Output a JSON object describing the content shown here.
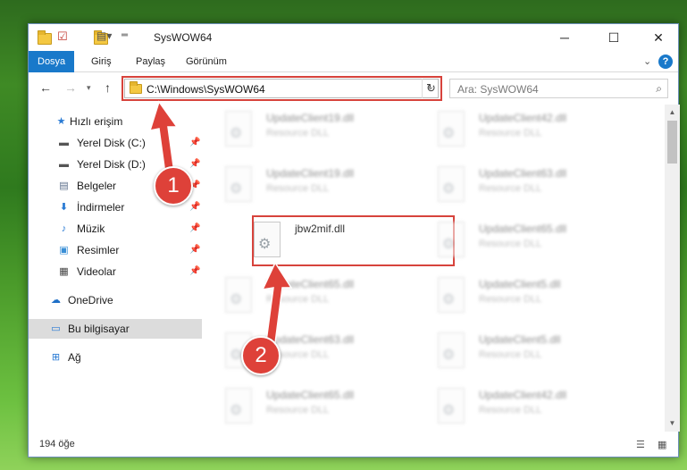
{
  "window": {
    "title": "SysWOW64"
  },
  "titlebar": {
    "minimize": "─",
    "maximize": "☐",
    "close": "✕"
  },
  "ribbon": {
    "tabs": [
      "Dosya",
      "Giriş",
      "Paylaş",
      "Görünüm"
    ],
    "active": 0
  },
  "address": {
    "path": "C:\\Windows\\SysWOW64",
    "search_placeholder": "Ara: SysWOW64"
  },
  "sidebar": {
    "items": [
      {
        "label": "Hızlı erişim",
        "icon": "star-icon"
      },
      {
        "label": "Yerel Disk (C:)",
        "icon": "drive-icon",
        "pinned": true
      },
      {
        "label": "Yerel Disk (D:)",
        "icon": "drive-icon",
        "pinned": true
      },
      {
        "label": "Belgeler",
        "icon": "documents-icon",
        "pinned": true
      },
      {
        "label": "İndirmeler",
        "icon": "download-icon",
        "pinned": true
      },
      {
        "label": "Müzik",
        "icon": "music-icon",
        "pinned": true
      },
      {
        "label": "Resimler",
        "icon": "pictures-icon",
        "pinned": true
      },
      {
        "label": "Videolar",
        "icon": "videos-icon",
        "pinned": true
      },
      {
        "label": "OneDrive",
        "icon": "cloud-icon"
      },
      {
        "label": "Bu bilgisayar",
        "icon": "computer-icon",
        "selected": true
      },
      {
        "label": "Ağ",
        "icon": "network-icon"
      }
    ]
  },
  "files": {
    "left": [
      {
        "name": "UpdateClient19.dll",
        "type": "Resource DLL",
        "blurred": true
      },
      {
        "name": "UpdateClient19.dll",
        "type": "Resource DLL",
        "blurred": true
      },
      {
        "name": "jbw2mif.dll",
        "type": "",
        "blurred": false
      },
      {
        "name": "UpdateClient65.dll",
        "type": "Resource DLL",
        "blurred": true
      },
      {
        "name": "UpdateClient63.dll",
        "type": "Resource DLL",
        "blurred": true
      },
      {
        "name": "UpdateClient65.dll",
        "type": "Resource DLL",
        "blurred": true
      }
    ],
    "right": [
      {
        "name": "UpdateClient42.dll",
        "type": "Resource DLL",
        "blurred": true
      },
      {
        "name": "UpdateClient63.dll",
        "type": "Resource DLL",
        "blurred": true
      },
      {
        "name": "UpdateClient65.dll",
        "type": "Resource DLL",
        "blurred": true
      },
      {
        "name": "UpdateClient5.dll",
        "type": "Resource DLL",
        "blurred": true
      },
      {
        "name": "UpdateClient5.dll",
        "type": "Resource DLL",
        "blurred": true
      },
      {
        "name": "UpdateClient42.dll",
        "type": "Resource DLL",
        "blurred": true
      }
    ]
  },
  "status": {
    "count": "194 öğe"
  },
  "annotations": {
    "step1": "1",
    "step2": "2",
    "color": "#de4139"
  }
}
